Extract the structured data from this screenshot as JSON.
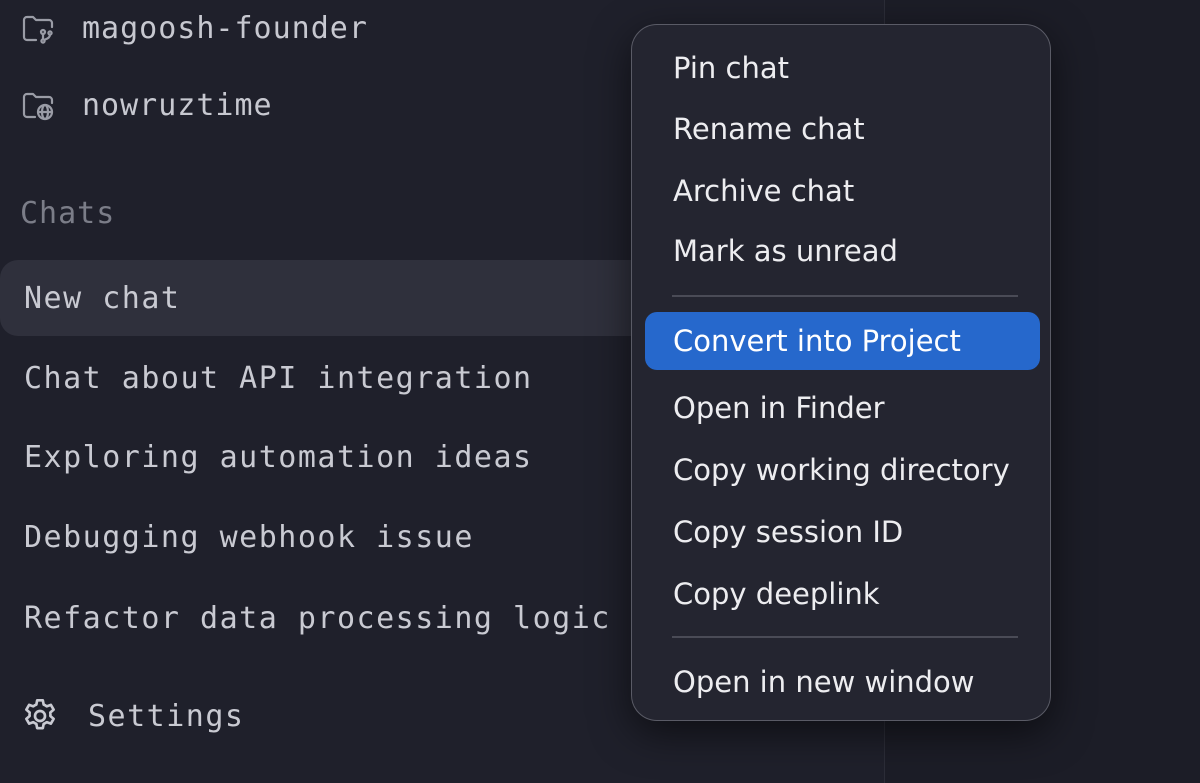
{
  "projects": [
    {
      "label": "magoosh-founder",
      "icon": "folder-git-icon"
    },
    {
      "label": "nowruztime",
      "icon": "folder-globe-icon"
    }
  ],
  "chats_section": {
    "heading": "Chats",
    "items": [
      {
        "label": "New chat",
        "active": true
      },
      {
        "label": "Chat about API integration"
      },
      {
        "label": "Exploring automation ideas"
      },
      {
        "label": "Debugging webhook issue"
      },
      {
        "label": "Refactor data processing logic"
      }
    ]
  },
  "settings": {
    "label": "Settings",
    "icon": "gear-icon"
  },
  "context_menu": {
    "group1": [
      "Pin chat",
      "Rename chat",
      "Archive chat",
      "Mark as unread"
    ],
    "group2": [
      "Convert into Project",
      "Open in Finder",
      "Copy working directory",
      "Copy session ID",
      "Copy deeplink"
    ],
    "group3": [
      "Open in new window"
    ],
    "highlighted": "Convert into Project",
    "highlight_color": "#2668cc"
  },
  "colors": {
    "background": "#1f202b",
    "active_row": "#2f303c",
    "menu_background": "#242530"
  }
}
